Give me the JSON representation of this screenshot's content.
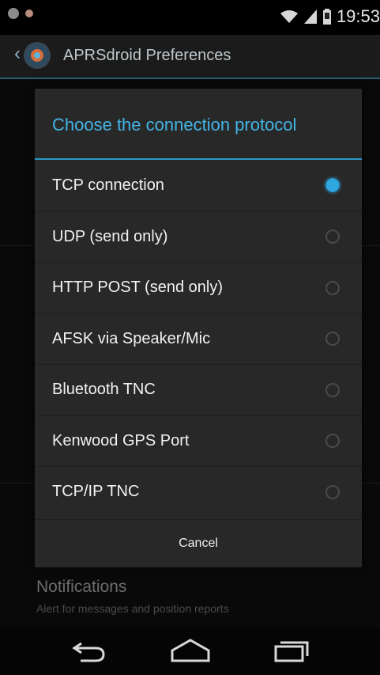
{
  "status_bar": {
    "time": "19:53"
  },
  "action_bar": {
    "title": "APRSdroid Preferences"
  },
  "background": {
    "notifications_title": "Notifications",
    "notifications_subtitle": "Alert for messages and position reports"
  },
  "dialog": {
    "title": "Choose the connection protocol",
    "selected_index": 0,
    "options": [
      {
        "label": "TCP connection"
      },
      {
        "label": "UDP (send only)"
      },
      {
        "label": "HTTP POST (send only)"
      },
      {
        "label": "AFSK via Speaker/Mic"
      },
      {
        "label": "Bluetooth TNC"
      },
      {
        "label": "Kenwood GPS Port"
      },
      {
        "label": "TCP/IP TNC"
      }
    ],
    "cancel_label": "Cancel"
  },
  "colors": {
    "accent": "#31a7df"
  },
  "icons": {
    "back": "back-icon",
    "home": "home-icon",
    "recents": "recents-icon",
    "wifi": "wifi-icon",
    "signal": "signal-icon",
    "battery": "battery-icon"
  }
}
